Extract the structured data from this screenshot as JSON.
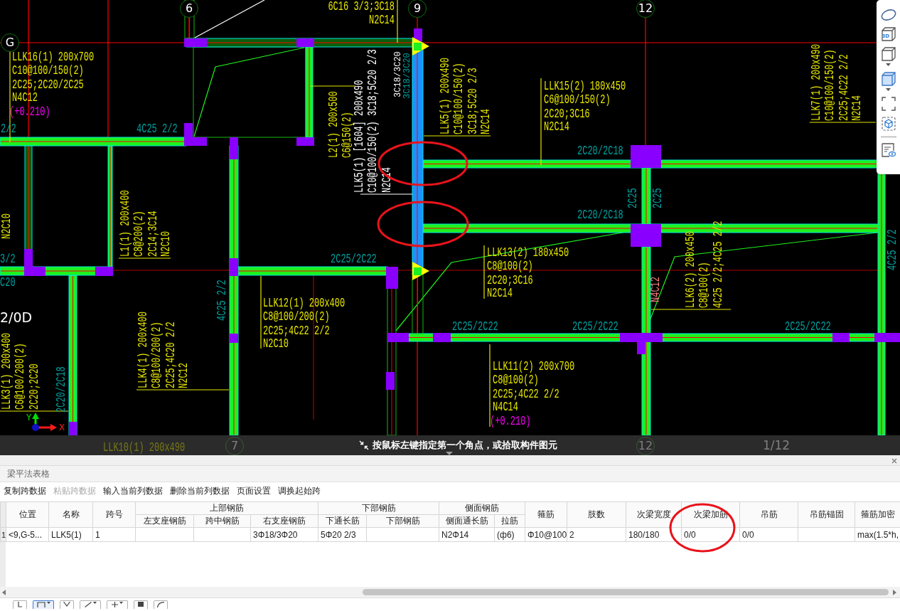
{
  "drawing": {
    "axis_bubbles": [
      "G",
      "6",
      "9",
      "12"
    ],
    "annotations": [
      {
        "kind": "horizontal",
        "color": "#e6e600",
        "lines": [
          "6C16 3/3;3C18",
          "N2C14"
        ]
      },
      {
        "kind": "horizontal",
        "color": "#e6e600",
        "lines": [
          "LLK16(1) 200x700",
          "C10@100/150(2)",
          "2C25;2C20/2C25",
          "N4C12"
        ],
        "elevation": "(+0.210)"
      },
      {
        "kind": "horizontal",
        "color": "#00a0a0",
        "lines": [
          "2/2"
        ]
      },
      {
        "kind": "horizontal",
        "color": "#00a0a0",
        "lines": [
          "4C25 2/2"
        ]
      },
      {
        "kind": "vertical",
        "color": "#e6e600",
        "lines": [
          "L2(1) 200x500",
          "C6@150(2)"
        ]
      },
      {
        "kind": "vertical",
        "color": "#ffffff",
        "lines": [
          "LLK5(1) [1604] 200x490",
          "C10@100/150(2) 3C18;5C20 2/3",
          "N2C14"
        ]
      },
      {
        "kind": "vertical",
        "color": "#ffffff",
        "lines": [
          "3C18/3C20"
        ]
      },
      {
        "kind": "vertical",
        "color": "#00a0a0",
        "lines": [
          "3C18/3C20"
        ]
      },
      {
        "kind": "vertical",
        "color": "#e6e600",
        "lines": [
          "LLK5(1) 200x490",
          "C10@100/150(2)",
          "3C18;5C20 2/3",
          "N2C14"
        ]
      },
      {
        "kind": "horizontal",
        "color": "#e6e600",
        "lines": [
          "LLK15(2) 180x450",
          "C6@100/150(2)",
          "2C20;3C16",
          "N2C14"
        ]
      },
      {
        "kind": "vertical",
        "color": "#e6e600",
        "lines": [
          "LLK7(1) 200x490",
          "C10@100/150(2)",
          "2C25;4C22 2/2",
          "N2C14"
        ]
      },
      {
        "kind": "horizontal",
        "color": "#00a0a0",
        "lines": [
          "2C20/2C18"
        ]
      },
      {
        "kind": "vertical",
        "color": "#00a0a0",
        "lines": [
          "2C25"
        ]
      },
      {
        "kind": "vertical",
        "color": "#00a0a0",
        "lines": [
          "2C25"
        ]
      },
      {
        "kind": "horizontal",
        "color": "#00a0a0",
        "lines": [
          "2C20/2C18"
        ]
      },
      {
        "kind": "vertical",
        "color": "#e6e600",
        "lines": [
          "N2C10"
        ]
      },
      {
        "kind": "vertical",
        "color": "#e6e600",
        "lines": [
          "L1(1) 200x400",
          "C8@200(2)",
          "2C14;3C14",
          "N2C10"
        ]
      },
      {
        "kind": "vertical",
        "color": "#e6e600",
        "lines": [
          "LLK6(2) 200x450",
          "C8@100(2)",
          "4C25 2/2;4C25 2/2"
        ]
      },
      {
        "kind": "vertical",
        "color": "#00a0a0",
        "lines": [
          "4C25 2/2"
        ]
      },
      {
        "kind": "horizontal",
        "color": "#e6e600",
        "lines": [
          "LLK13(2) 180x450",
          "C8@100(2)",
          "2C20;3C16",
          "N2C14"
        ]
      },
      {
        "kind": "horizontal",
        "color": "#00a0a0",
        "lines": [
          "3/2"
        ]
      },
      {
        "kind": "horizontal",
        "color": "#00a0a0",
        "lines": [
          "2C25/2C22"
        ]
      },
      {
        "kind": "horizontal",
        "color": "#00a0a0",
        "lines": [
          "C20"
        ]
      },
      {
        "kind": "vertical",
        "color": "#00a0a0",
        "lines": [
          "4C25 2/2"
        ]
      },
      {
        "kind": "vertical",
        "color": "#ff8080",
        "lines": [
          "N4C12"
        ]
      },
      {
        "kind": "horizontal",
        "color": "#e6e600",
        "lines": [
          "LLK12(1) 200x400",
          "C8@100/200(2)",
          "2C25;4C22 2/2",
          "N2C10"
        ]
      },
      {
        "kind": "vertical",
        "color": "#e6e600",
        "lines": [
          "LLK4(1) 200x400",
          "C8@100/200(2)",
          "2C25;4C20 2/2",
          "N2C12"
        ]
      },
      {
        "kind": "horizontal",
        "color": "#00a0a0",
        "lines": [
          "2C25/2C22"
        ]
      },
      {
        "kind": "horizontal",
        "color": "#00a0a0",
        "lines": [
          "2C25/2C22"
        ]
      },
      {
        "kind": "horizontal",
        "color": "#00a0a0",
        "lines": [
          "2C25/2C22"
        ]
      },
      {
        "kind": "vertical",
        "color": "#e6e600",
        "lines": [
          "LLK3(1) 200x400",
          "C6@100/200(2)",
          "2C20;2C20"
        ]
      },
      {
        "kind": "vertical",
        "color": "#00a0a0",
        "lines": [
          "2C20/2C18"
        ]
      },
      {
        "kind": "horizontal",
        "color": "#e6e600",
        "lines": [
          "LLK11(2) 200x700",
          "C8@100(2)",
          "2C25;4C22 2/2",
          "N4C14"
        ],
        "elevation": "(+0.210)"
      },
      {
        "kind": "plain",
        "color": "#ffffff",
        "lines": [
          "2/0D"
        ]
      }
    ],
    "ucs": {
      "y_label": "Y",
      "x_label": "X"
    }
  },
  "view_toolbar": {
    "cube_label": "3D"
  },
  "status_bar": {
    "message": "按鼠标左键指定第一个角点，或拾取构件图元",
    "labels_behind": [
      {
        "kind": "annotation",
        "text": "LLK10(1) 200x490"
      },
      {
        "kind": "axis",
        "text": "7"
      },
      {
        "kind": "axis",
        "text": "12"
      },
      {
        "kind": "text",
        "text": "1/12"
      }
    ]
  },
  "panel": {
    "title": "梁平法表格",
    "toolbar": [
      {
        "label": "复制跨数据",
        "disabled": false
      },
      {
        "label": "粘贴跨数据",
        "disabled": true
      },
      {
        "label": "输入当前列数据",
        "disabled": false
      },
      {
        "label": "删除当前列数据",
        "disabled": false
      },
      {
        "label": "页面设置",
        "disabled": false
      },
      {
        "label": "调换起始跨",
        "disabled": false
      }
    ],
    "table": {
      "header_rows": [
        [
          {
            "label": "位置",
            "rowspan": 2
          },
          {
            "label": "名称",
            "rowspan": 2
          },
          {
            "label": "跨号",
            "rowspan": 2
          },
          {
            "label": "上部钢筋",
            "colspan": 3
          },
          {
            "label": "下部钢筋",
            "colspan": 2
          },
          {
            "label": "侧面钢筋",
            "colspan": 2
          },
          {
            "label": "箍筋",
            "rowspan": 2
          },
          {
            "label": "肢数",
            "rowspan": 2
          },
          {
            "label": "次梁宽度",
            "rowspan": 2
          },
          {
            "label": "次梁加筋",
            "rowspan": 2
          },
          {
            "label": "吊筋",
            "rowspan": 2
          },
          {
            "label": "吊筋锚固",
            "rowspan": 2
          },
          {
            "label": "箍筋加密",
            "rowspan": 2
          }
        ],
        [
          {
            "label": "左支座钢筋"
          },
          {
            "label": "跨中钢筋"
          },
          {
            "label": "右支座钢筋"
          },
          {
            "label": "下通长筋"
          },
          {
            "label": "下部钢筋"
          },
          {
            "label": "侧面通长筋"
          },
          {
            "label": "拉筋"
          }
        ]
      ],
      "rows": [
        {
          "number": "1",
          "cells": [
            "<9,G-5...",
            "LLK5(1)",
            "1",
            null,
            null,
            "3Φ18/3Φ20",
            "5Φ20 2/3",
            null,
            "N2Φ14",
            "(ф6)",
            "Φ10@100",
            "2",
            "180/180",
            "0/0",
            "0/0",
            null,
            "max(1.5*h,"
          ]
        }
      ]
    }
  }
}
